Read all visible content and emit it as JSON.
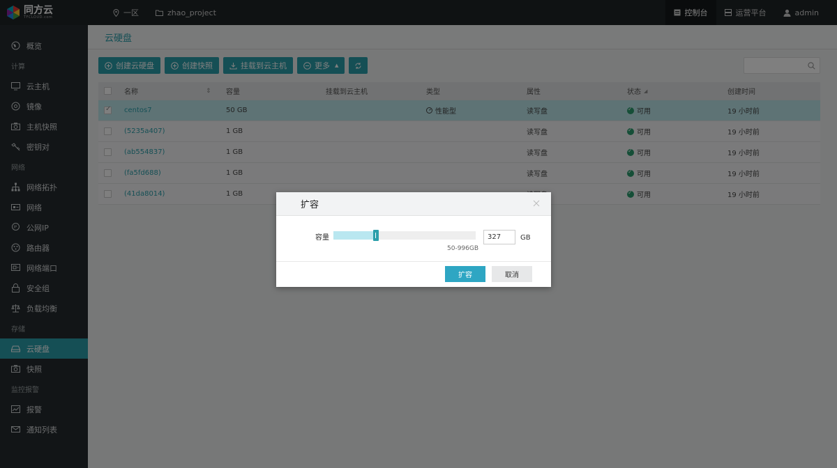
{
  "brand": {
    "name": "同方云",
    "sub": "TFCLOUD.com",
    "accent": "#2b9fab"
  },
  "topbar": {
    "region_icon": "location-pin-icon",
    "region": "一区",
    "project_icon": "folder-icon",
    "project": "zhao_project",
    "console": "控制台",
    "ops": "运营平台",
    "user": "admin"
  },
  "sidebar": {
    "overview": "概览",
    "groups": {
      "compute": "计算",
      "network": "网络",
      "storage": "存储",
      "monitor": "监控报警"
    },
    "items": {
      "vm": "云主机",
      "image": "镜像",
      "host_snapshot": "主机快照",
      "keypair": "密钥对",
      "topology": "网络拓扑",
      "network": "网络",
      "public_ip": "公网IP",
      "router": "路由器",
      "port": "网络端口",
      "security_group": "安全组",
      "lb": "负载均衡",
      "disk": "云硬盘",
      "snapshot": "快照",
      "alarm": "报警",
      "notify_list": "通知列表"
    }
  },
  "page": {
    "title": "云硬盘",
    "toolbar": {
      "create_disk": "创建云硬盘",
      "create_snapshot": "创建快照",
      "attach": "挂载到云主机",
      "more": "更多"
    },
    "search_placeholder": ""
  },
  "table": {
    "headers": {
      "name": "名称",
      "size": "容量",
      "attached": "挂载到云主机",
      "type": "类型",
      "attr": "属性",
      "status": "状态",
      "created": "创建时间"
    },
    "rows": [
      {
        "name": "centos7",
        "size": "50 GB",
        "attached": "",
        "type": "性能型",
        "attr": "读写盘",
        "status": "可用",
        "created": "19 小时前",
        "selected": true
      },
      {
        "name": "(5235a407)",
        "size": "1 GB",
        "attached": "",
        "type": "",
        "attr": "读写盘",
        "status": "可用",
        "created": "19 小时前",
        "selected": false
      },
      {
        "name": "(ab554837)",
        "size": "1 GB",
        "attached": "",
        "type": "",
        "attr": "读写盘",
        "status": "可用",
        "created": "19 小时前",
        "selected": false
      },
      {
        "name": "(fa5fd688)",
        "size": "1 GB",
        "attached": "",
        "type": "",
        "attr": "读写盘",
        "status": "可用",
        "created": "19 小时前",
        "selected": false
      },
      {
        "name": "(41da8014)",
        "size": "1 GB",
        "attached": "",
        "type": "",
        "attr": "读写盘",
        "status": "可用",
        "created": "19 小时前",
        "selected": false
      }
    ]
  },
  "modal": {
    "title": "扩容",
    "capacity_label": "容量",
    "range": "50-996GB",
    "range_min": 50,
    "range_max": 996,
    "value": "327",
    "value_num": 327,
    "unit": "GB",
    "ok": "扩容",
    "cancel": "取消"
  }
}
